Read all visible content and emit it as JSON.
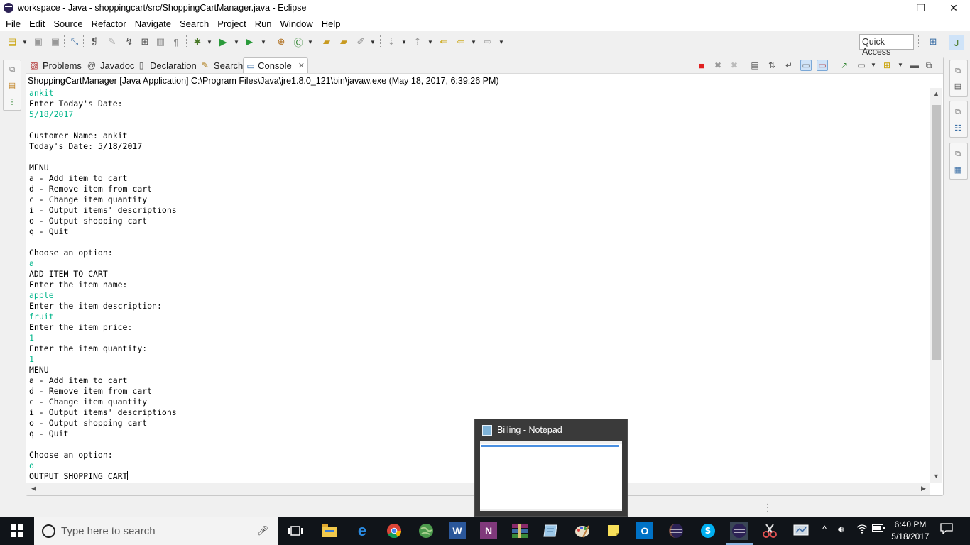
{
  "window": {
    "title": "workspace - Java - shoppingcart/src/ShoppingCartManager.java - Eclipse",
    "minimize": "—",
    "restore": "❐",
    "close": "✕"
  },
  "menu": [
    "File",
    "Edit",
    "Source",
    "Refactor",
    "Navigate",
    "Search",
    "Project",
    "Run",
    "Window",
    "Help"
  ],
  "toolbar": {
    "quick_access": "Quick Access"
  },
  "tabs": [
    {
      "label": "Problems",
      "icon": "problems-icon"
    },
    {
      "label": "Javadoc",
      "icon": "at-icon"
    },
    {
      "label": "Declaration",
      "icon": "declaration-icon"
    },
    {
      "label": "Search",
      "icon": "flashlight-icon"
    },
    {
      "label": "Console",
      "icon": "console-icon",
      "active": true
    }
  ],
  "console": {
    "launch": "ShoppingCartManager [Java Application] C:\\Program Files\\Java\\jre1.8.0_121\\bin\\javaw.exe (May 18, 2017, 6:39:26 PM)",
    "lines": [
      {
        "t": "ankit",
        "input": true
      },
      {
        "t": "Enter Today's Date:"
      },
      {
        "t": "5/18/2017",
        "input": true
      },
      {
        "t": ""
      },
      {
        "t": "Customer Name: ankit"
      },
      {
        "t": "Today's Date: 5/18/2017"
      },
      {
        "t": ""
      },
      {
        "t": "MENU"
      },
      {
        "t": "a - Add item to cart"
      },
      {
        "t": "d - Remove item from cart"
      },
      {
        "t": "c - Change item quantity"
      },
      {
        "t": "i - Output items' descriptions"
      },
      {
        "t": "o - Output shopping cart"
      },
      {
        "t": "q - Quit"
      },
      {
        "t": ""
      },
      {
        "t": "Choose an option:"
      },
      {
        "t": "a",
        "input": true
      },
      {
        "t": "ADD ITEM TO CART"
      },
      {
        "t": "Enter the item name:"
      },
      {
        "t": "apple",
        "input": true
      },
      {
        "t": "Enter the item description:"
      },
      {
        "t": "fruit",
        "input": true
      },
      {
        "t": "Enter the item price:"
      },
      {
        "t": "1",
        "input": true
      },
      {
        "t": "Enter the item quantity:"
      },
      {
        "t": "1",
        "input": true
      },
      {
        "t": "MENU"
      },
      {
        "t": "a - Add item to cart"
      },
      {
        "t": "d - Remove item from cart"
      },
      {
        "t": "c - Change item quantity"
      },
      {
        "t": "i - Output items' descriptions"
      },
      {
        "t": "o - Output shopping cart"
      },
      {
        "t": "q - Quit"
      },
      {
        "t": ""
      },
      {
        "t": "Choose an option:"
      },
      {
        "t": "o",
        "input": true
      },
      {
        "t": "OUTPUT SHOPPING CART",
        "caret": true
      }
    ]
  },
  "notepad_preview": {
    "title": "Billing - Notepad"
  },
  "taskbar": {
    "search_placeholder": "Type here to search",
    "time": "6:40 PM",
    "date": "5/18/2017"
  },
  "colors": {
    "console_input": "#00b58a",
    "taskbar_bg": "#101419"
  }
}
